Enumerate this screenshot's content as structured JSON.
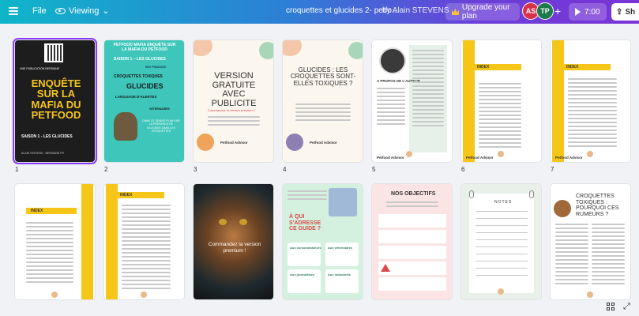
{
  "topbar": {
    "file_label": "File",
    "viewing_label": "Viewing",
    "title": "croquettes et glucides 2- petfo...",
    "author": "by Alain STEVENS",
    "upgrade_label": "Upgrade your plan",
    "avatar_1": "AS",
    "avatar_2": "TP",
    "plus": "+",
    "timer": "7:00",
    "share_label": "Sh"
  },
  "pages": {
    "p1": {
      "num": "1",
      "small": "UNE PUBLICATION BERSIANE",
      "title": "ENQUÊTE SUR LA MAFIA DU PETFOOD",
      "subtitle": "SAISON 1 - LES GLUCIDES",
      "author": "ALAIN STEVENS - BERSIANE.FR"
    },
    "p2": {
      "num": "2",
      "title": "PETFOOD MAFIA ENQUÊTE SUR LA MAFIA DU PETFOOD",
      "season": "SAISON 1 – LES GLUCIDES",
      "w1": "BIG PINANCE",
      "w2": "CROQUETTES TOXIQUES",
      "w3": "GLUCIDES",
      "w4": "LANGUAGE D'ALERTES",
      "w5": "VETERINAIRES",
      "note": "DANS CE GRAND PLAN SUR LA PRÉSENCE DE GLUCIDES DANS LES CROQUETTES"
    },
    "p3": {
      "num": "3",
      "title": "VERSION GRATUITE AVEC PUBLICITE",
      "sub": "Commandez la version premium !",
      "brand": "Petfood Advisor"
    },
    "p4": {
      "num": "4",
      "title": "GLUCIDES : LES CROQUETTES SONT-ELLES TOXIQUES ?",
      "brand": "Petfood Advisor"
    },
    "p5": {
      "num": "5",
      "about": "A PROPOS DE L'AUTEUR",
      "brand": "Petfood Advisor"
    },
    "p6": {
      "num": "6",
      "index": "INDEX",
      "brand": "Petfood Advisor"
    },
    "p7": {
      "num": "7",
      "index": "INDEX",
      "brand": "Petfood Advisor"
    },
    "p8": {
      "num": "",
      "index": "INDEX"
    },
    "p9": {
      "num": "",
      "index": "INDEX"
    },
    "p10": {
      "num": "",
      "caption": "Commandez la version premium !"
    },
    "p11": {
      "num": "",
      "q": "À QUI S'ADRESSE CE GUIDE ?",
      "l1": "Aux consommateurs",
      "l2": "Aux vétérinaires",
      "l3": "Aux journalistes",
      "l4": "Aux industriels"
    },
    "p12": {
      "num": "",
      "title": "NOS OBJECTIFS"
    },
    "p13": {
      "num": "",
      "title": "NOTES"
    },
    "p14": {
      "num": "",
      "title": "CROQUETTES TOXIQUES : POURQUOI CES RUMEURS ?"
    }
  },
  "colors": {
    "accent": "#8b3dff",
    "yellow": "#f5c518",
    "teal": "#35c2b3"
  }
}
